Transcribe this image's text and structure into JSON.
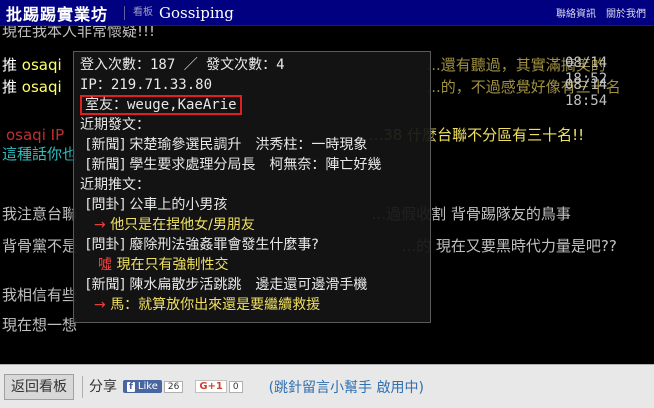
{
  "header": {
    "site_title": "批踢踢實業坊",
    "board_label": "看板",
    "board_name": "Gossiping",
    "links": [
      "聯絡資訊",
      "關於我們"
    ]
  },
  "content": {
    "line0": "現在我本人非常懷疑!!!",
    "pushes": [
      {
        "tag": "推",
        "user": "osaqi",
        "text": "...還有聽過，其實滿搞笑的",
        "time": "08/14 18:52"
      },
      {
        "tag": "推",
        "user": "osaqi",
        "text": "...的，不過感覺好像有三十名",
        "time": "08/14 18:54"
      }
    ],
    "line3_user": "osaqi",
    "line3_ip": "IP",
    "line3_tail": "...38 什麼台聯不分區有三十名!!",
    "line4": "這種話你也",
    "line5": "我注意台聯",
    "line5_tail": "...過假收割 背骨踢隊友的鳥事",
    "line6": "背骨黨不是",
    "line6_tail": "...的 現在又要黑時代力量是吧??",
    "line7": "我相信有些",
    "line8": "現在想一想"
  },
  "popup": {
    "login_count": "登入次數：187 ／ 發文次數：4",
    "ip": "IP：219.71.33.80",
    "roommate": "室友：weuge,KaeArie",
    "recent_posts_label": "近期發文：",
    "posts": [
      "[新聞] 宋楚瑜參選民調升　洪秀柱：一時現象",
      "[新聞] 學生要求處理分局長　柯無奈：陣亡好幾"
    ],
    "recent_pushes_label": "近期推文：",
    "pushes": [
      {
        "title": "[問卦] 公車上的小男孩",
        "marker": "→",
        "reply": "他只是在捏他女/男朋友",
        "kind": "arrow"
      },
      {
        "title": "[問卦] 廢除刑法強姦罪會發生什麼事?",
        "marker": "噓",
        "reply": "現在只有強制性交",
        "kind": "boo"
      },
      {
        "title": "[新聞] 陳水扁散步活跳跳　邊走還可邊滑手機",
        "marker": "→",
        "reply": "馬：就算放你出來還是要繼續救援",
        "kind": "arrow"
      }
    ]
  },
  "footer": {
    "back_label": "返回看板",
    "share_label": "分享",
    "like_label": "Like",
    "like_count": "26",
    "gplus_label": "G+1",
    "gplus_count": "0",
    "helper_text": "(跳針留言小幫手 啟用中)"
  },
  "colors": {
    "header_bg": "#000080",
    "roommate_border": "#e02020",
    "push_user": "#ffff66",
    "helper_link": "#3070b0"
  }
}
